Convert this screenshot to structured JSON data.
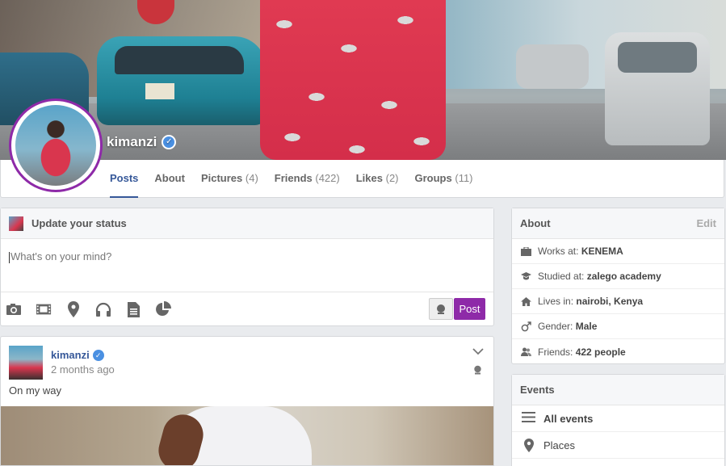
{
  "profile": {
    "name": "kimanzi",
    "verified": true,
    "tabs": [
      {
        "label": "Posts",
        "count": ""
      },
      {
        "label": "About",
        "count": ""
      },
      {
        "label": "Pictures",
        "count": "(4)"
      },
      {
        "label": "Friends",
        "count": "(422)"
      },
      {
        "label": "Likes",
        "count": "(2)"
      },
      {
        "label": "Groups",
        "count": "(11)"
      }
    ],
    "active_tab": "Posts"
  },
  "status": {
    "title": "Update your status",
    "placeholder": "What's on your mind?",
    "tools": [
      "camera-icon",
      "video-icon",
      "location-pin-icon",
      "headphones-icon",
      "document-icon",
      "pie-chart-icon"
    ],
    "post_label": "Post"
  },
  "post": {
    "author": "kimanzi",
    "time": "2 months ago",
    "text": "On my way"
  },
  "about": {
    "title": "About",
    "edit_label": "Edit",
    "rows": [
      {
        "icon": "briefcase-icon",
        "label": "Works at:",
        "value": "KENEMA"
      },
      {
        "icon": "graduation-cap-icon",
        "label": "Studied at:",
        "value": "zalego academy"
      },
      {
        "icon": "home-icon",
        "label": "Lives in:",
        "value": "nairobi, Kenya"
      },
      {
        "icon": "male-icon",
        "label": "Gender:",
        "value": "Male"
      },
      {
        "icon": "friends-icon",
        "label": "Friends:",
        "value": "422 people"
      }
    ]
  },
  "events": {
    "title": "Events",
    "items": [
      {
        "icon": "menu-icon",
        "label": "All events"
      },
      {
        "icon": "map-pin-icon",
        "label": "Places"
      }
    ]
  },
  "colors": {
    "accent": "#8e2aa8",
    "link": "#365899",
    "verified": "#4a90e2"
  }
}
